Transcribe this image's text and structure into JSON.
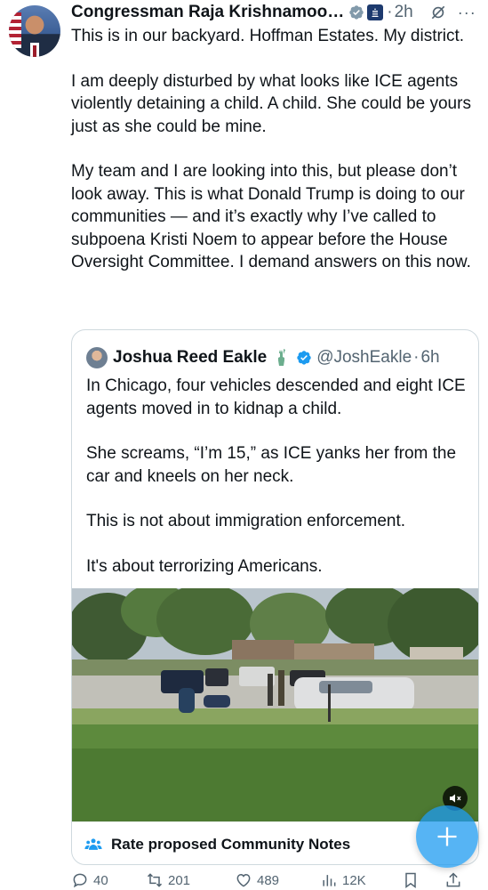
{
  "tweet": {
    "author": "Congressman Raja Krishnamoo…",
    "time": "2h",
    "paragraphs": [
      "This is in our backyard. Hoffman Estates. My district.",
      "I am deeply disturbed by what looks like ICE agents violently detaining a child. A child. She could be yours just as she could be mine.",
      "My team and I are looking into this, but please don’t look away. This is what Donald Trump is doing to our communities — and it’s exactly why I’ve called to subpoena Kristi Noem to appear before the House Oversight Committee. I demand answers on this now."
    ]
  },
  "quote": {
    "author": "Joshua Reed Eakle",
    "handle": "@JoshEakle",
    "time": "6h",
    "paragraphs": [
      "In Chicago, four vehicles descended and eight ICE agents moved in to kidnap a child.",
      "She screams, “I’m 15,” as ICE yanks her from the car and kneels on her neck.",
      "This is not about immigration enforcement.",
      "It's about terrorizing Americans."
    ]
  },
  "community_notes": {
    "label": "Rate proposed Community Notes"
  },
  "actions": {
    "replies": "40",
    "reposts": "201",
    "likes": "489",
    "views": "12K"
  },
  "icons": {
    "verified": "verified-badge-icon",
    "grok": "grok-icon",
    "more": "more-icon",
    "mute": "mute-icon",
    "community_notes": "community-notes-icon",
    "compose": "compose-icon",
    "reply": "reply-icon",
    "repost": "repost-icon",
    "like": "like-icon",
    "views": "views-icon",
    "bookmark": "bookmark-icon",
    "share": "share-icon"
  },
  "colors": {
    "accent": "#1d9bf0",
    "muted": "#536471",
    "text": "#0f1419"
  }
}
